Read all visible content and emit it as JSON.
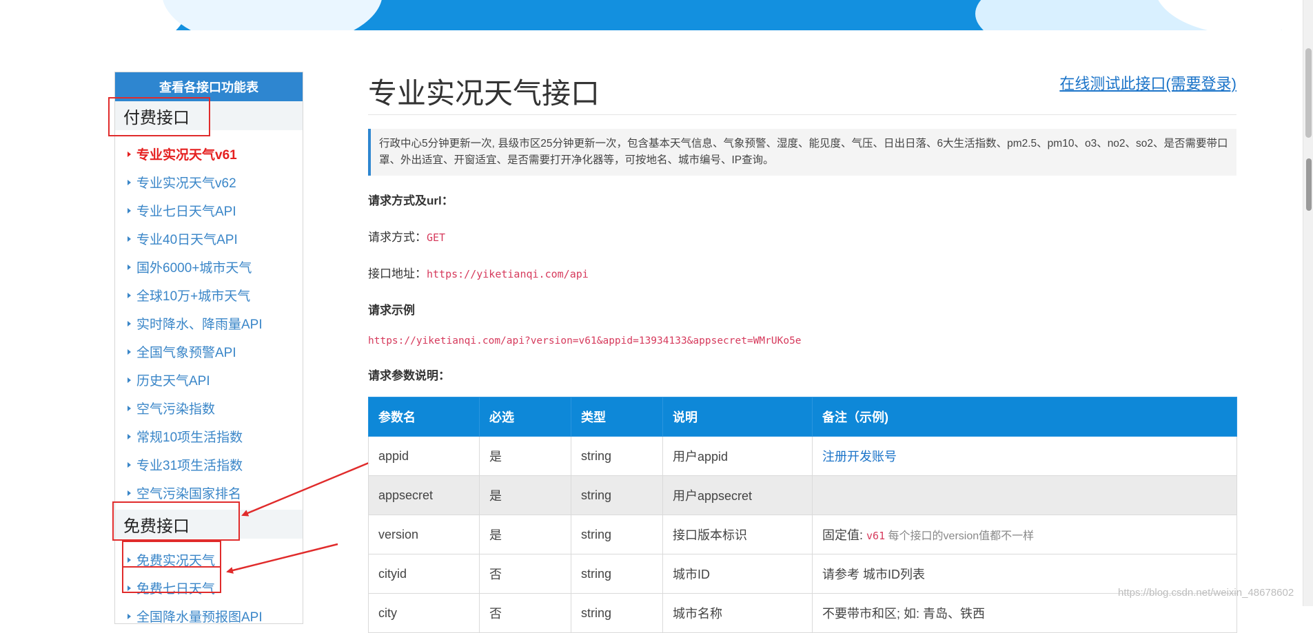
{
  "sidebar": {
    "header": "查看各接口功能表",
    "paid_title": "付费接口",
    "paid_items": [
      {
        "label": "专业实况天气v61",
        "active": true
      },
      {
        "label": "专业实况天气v62"
      },
      {
        "label": "专业七日天气API"
      },
      {
        "label": "专业40日天气API"
      },
      {
        "label": "国外6000+城市天气"
      },
      {
        "label": "全球10万+城市天气"
      },
      {
        "label": "实时降水、降雨量API"
      },
      {
        "label": "全国气象预警API"
      },
      {
        "label": "历史天气API"
      },
      {
        "label": "空气污染指数"
      },
      {
        "label": "常规10项生活指数"
      },
      {
        "label": "专业31项生活指数"
      },
      {
        "label": "空气污染国家排名"
      }
    ],
    "free_title": "免费接口",
    "free_items": [
      {
        "label": "免费实况天气"
      },
      {
        "label": "免费七日天气"
      },
      {
        "label": "全国降水量预报图API"
      }
    ]
  },
  "main": {
    "title": "专业实况天气接口",
    "test_link": "在线测试此接口(需要登录)",
    "description": "行政中心5分钟更新一次, 县级市区25分钟更新一次，包含基本天气信息、气象预警、湿度、能见度、气压、日出日落、6大生活指数、pm2.5、pm10、o3、no2、so2、是否需要带口罩、外出适宜、开窗适宜、是否需要打开净化器等，可按地名、城市编号、IP查询。",
    "request_section": "请求方式及url：",
    "method_label": "请求方式：",
    "method_value": "GET",
    "url_label": "接口地址：",
    "url_value": "https://yiketianqi.com/api",
    "example_title": "请求示例",
    "example_url": "https://yiketianqi.com/api?version=v61&appid=13934133&appsecret=WMrUKo5e",
    "params_title": "请求参数说明：",
    "table": {
      "headers": [
        "参数名",
        "必选",
        "类型",
        "说明",
        "备注（示例)"
      ],
      "rows": [
        {
          "name": "appid",
          "required": "是",
          "type": "string",
          "desc": "用户appid",
          "note": "注册开发账号"
        },
        {
          "name": "appsecret",
          "required": "是",
          "type": "string",
          "desc": "用户appsecret",
          "note": ""
        },
        {
          "name": "version",
          "required": "是",
          "type": "string",
          "desc": "接口版本标识",
          "note_prefix": "固定值: ",
          "note_code": "v61",
          "note_suffix": " 每个接口的version值都不一样"
        },
        {
          "name": "cityid",
          "required": "否",
          "type": "string",
          "desc": "城市ID",
          "note": "请参考 城市ID列表"
        },
        {
          "name": "city",
          "required": "否",
          "type": "string",
          "desc": "城市名称",
          "note": "不要带市和区; 如: 青岛、铁西"
        }
      ]
    }
  },
  "watermark": "https://blog.csdn.net/weixin_48678602",
  "colors": {
    "accent": "#0e88d8",
    "annotation": "#e02b2b",
    "link": "#1a73c8",
    "code": "#d63a5c"
  }
}
